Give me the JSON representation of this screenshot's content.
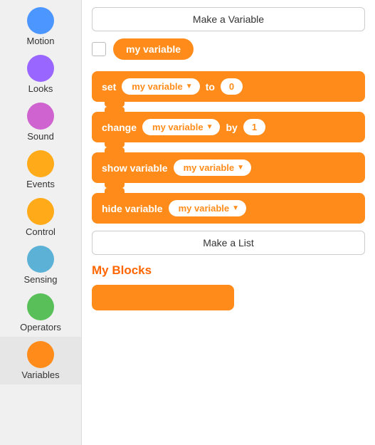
{
  "sidebar": {
    "items": [
      {
        "id": "motion",
        "label": "Motion",
        "color": "#4C97FF",
        "visible": false
      },
      {
        "id": "looks",
        "label": "Looks",
        "color": "#9966FF"
      },
      {
        "id": "sound",
        "label": "Sound",
        "color": "#CF63CF"
      },
      {
        "id": "events",
        "label": "Events",
        "color": "#FFAB19"
      },
      {
        "id": "control",
        "label": "Control",
        "color": "#FFAB19"
      },
      {
        "id": "sensing",
        "label": "Sensing",
        "color": "#5CB1D6"
      },
      {
        "id": "operators",
        "label": "Operators",
        "color": "#59C059"
      },
      {
        "id": "variables",
        "label": "Variables",
        "color": "#FF8C1A",
        "active": true
      }
    ]
  },
  "main": {
    "make_variable_label": "Make a Variable",
    "variable_name": "my variable",
    "blocks": [
      {
        "id": "set-block",
        "prefix": "set",
        "dropdown": "my variable",
        "middle": "to",
        "value": "0"
      },
      {
        "id": "change-block",
        "prefix": "change",
        "dropdown": "my variable",
        "middle": "by",
        "value": "1"
      },
      {
        "id": "show-block",
        "prefix": "show variable",
        "dropdown": "my variable"
      },
      {
        "id": "hide-block",
        "prefix": "hide variable",
        "dropdown": "my variable"
      }
    ],
    "make_list_label": "Make a List",
    "my_blocks_heading": "My Blocks"
  }
}
